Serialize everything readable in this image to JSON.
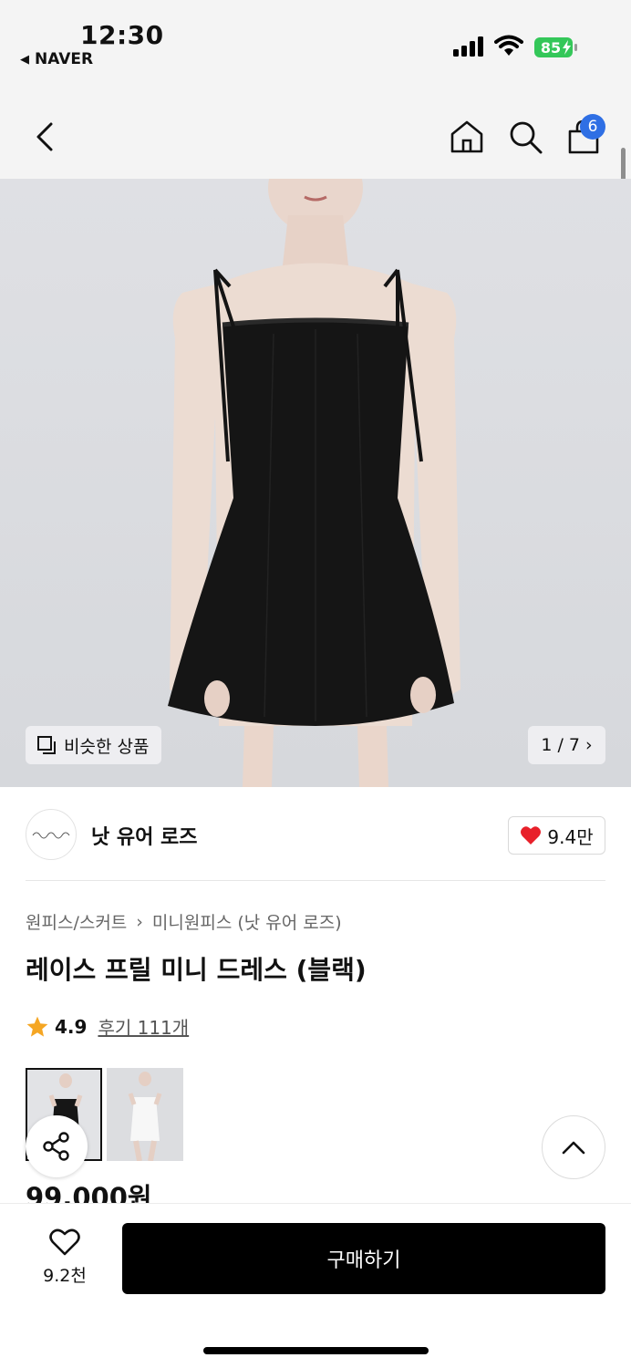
{
  "status_bar": {
    "time": "12:30",
    "back_app": "NAVER",
    "battery": "85"
  },
  "nav": {
    "cart_count": "6"
  },
  "gallery": {
    "similar_label": "비슷한 상품",
    "pager": "1 / 7"
  },
  "brand": {
    "name": "낫 유어 로즈",
    "likes": "9.4만"
  },
  "product": {
    "breadcrumb": [
      "원피스/스커트",
      "미니원피스 (낫 유어 로즈)"
    ],
    "title": "레이스 프릴 미니 드레스 (블랙)",
    "rating": "4.9",
    "reviews": "후기 111개",
    "price": "99,000원"
  },
  "bottom": {
    "wish_count": "9.2천",
    "buy_label": "구매하기"
  },
  "colors": {
    "accent_badge": "#2f6fe4",
    "battery_green": "#34c759",
    "heart_red": "#e8202a",
    "star_orange": "#f5a623"
  }
}
